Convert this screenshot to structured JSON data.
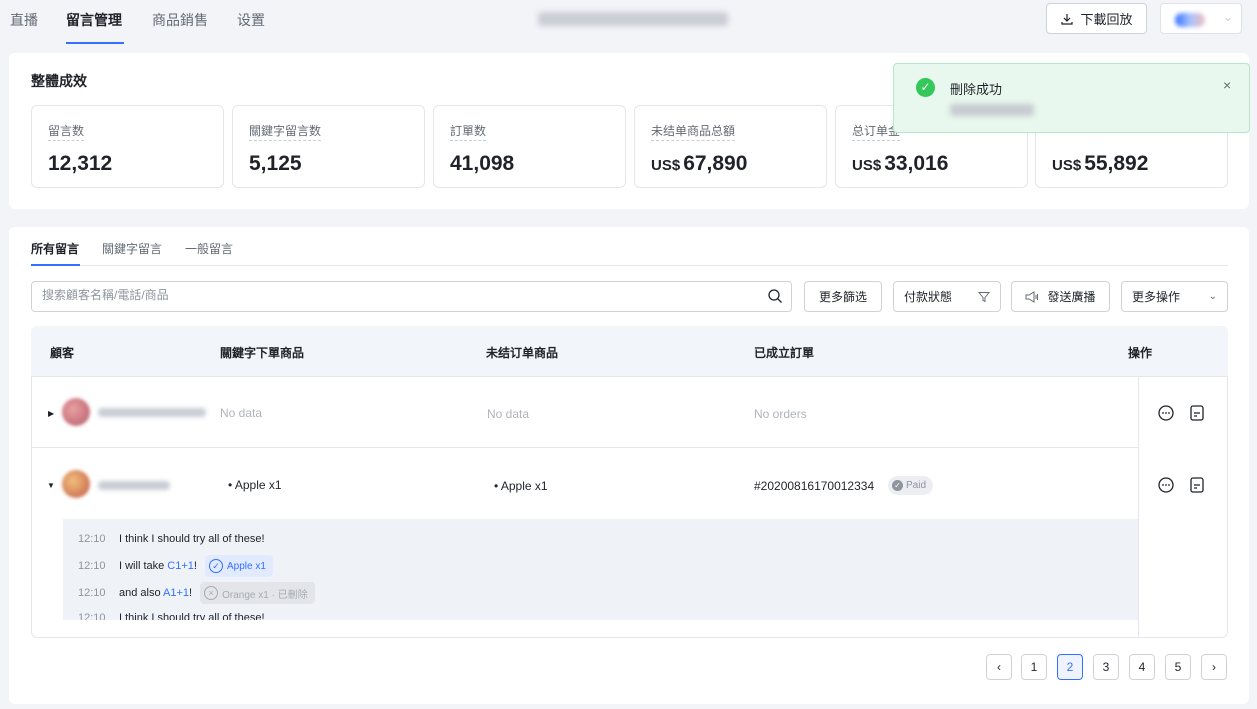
{
  "nav": {
    "tabs": [
      "直播",
      "留言管理",
      "商品銷售",
      "设置"
    ],
    "download_label": "下載回放"
  },
  "performance": {
    "title": "整體成效",
    "stats": [
      {
        "label": "留言数",
        "currency": "",
        "value": "12,312"
      },
      {
        "label": "關鍵字留言数",
        "currency": "",
        "value": "5,125"
      },
      {
        "label": "訂單数",
        "currency": "",
        "value": "41,098"
      },
      {
        "label": "未结单商品总額",
        "currency": "US$",
        "value": "67,890"
      },
      {
        "label": "总订单金",
        "currency": "US$",
        "value": "33,016"
      },
      {
        "label": "",
        "currency": "US$",
        "value": "55,892"
      }
    ]
  },
  "toast": {
    "title": "刪除成功",
    "close": "×"
  },
  "list": {
    "tabs": [
      "所有留言",
      "關鍵字留言",
      "一般留言"
    ],
    "search_placeholder": "搜索顧客名稱/電話/商品",
    "buttons": {
      "more_filter": "更多篩选",
      "pay_status": "付款狀態",
      "broadcast": "發送廣播",
      "more_actions": "更多操作"
    },
    "headers": [
      "顧客",
      "關鍵字下單商品",
      "未结订单商品",
      "已成立訂單",
      "操作"
    ],
    "rows": [
      {
        "keyword_items": "No data",
        "open_items": "No data",
        "orders": "No orders"
      },
      {
        "keyword_items": "Apple x1",
        "open_items": "Apple x1",
        "orders": "#20200816170012334",
        "order_status": "Paid"
      }
    ],
    "comments": [
      {
        "time": "12:10",
        "pre": "I think I should try all of these!",
        "kw": "",
        "post": "",
        "chip": "",
        "chip_state": ""
      },
      {
        "time": "12:10",
        "pre": "I will take ",
        "kw": "C1+1",
        "post": "!",
        "chip": "Apple x1",
        "chip_state": "ok"
      },
      {
        "time": "12:10",
        "pre": "and also ",
        "kw": "A1+1",
        "post": "!",
        "chip": "Orange x1 · 已刪除",
        "chip_state": "deleted"
      },
      {
        "time": "12:10",
        "pre": "I think I should try all of these!",
        "kw": "",
        "post": "",
        "chip": "",
        "chip_state": ""
      }
    ]
  },
  "pagination": {
    "pages": [
      "1",
      "2",
      "3",
      "4",
      "5"
    ],
    "current": "2"
  },
  "colors": {
    "accent": "#3370ff",
    "success": "#34c759",
    "toast_bg": "#e8f8ee"
  }
}
